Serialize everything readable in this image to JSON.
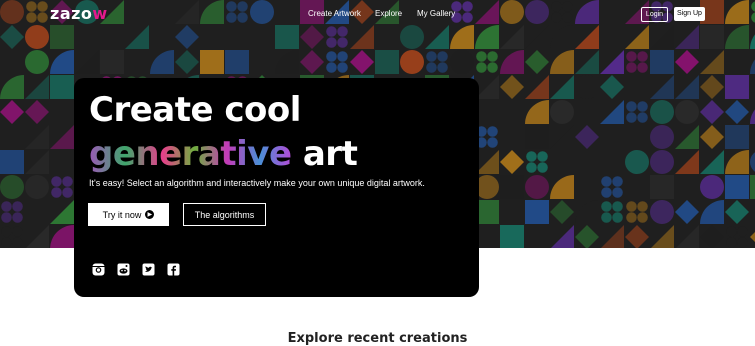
{
  "brand": {
    "logo_text": "zazo",
    "logo_accent": "w",
    "accent_color": "#e4198c"
  },
  "nav": {
    "links": [
      "Create Artwork",
      "Explore",
      "My Gallery"
    ],
    "login_label": "Login",
    "signup_label": "Sign Up"
  },
  "hero": {
    "title_line1": "Create cool",
    "title_highlight": "generative",
    "title_rest": " art",
    "tagline": "It's easy! Select an algorithm and interactively make your own unique digital artwork.",
    "cta_primary": "Try it now",
    "cta_primary_icon": "arrow-circle-right-icon",
    "cta_secondary": "The algorithms",
    "social_icons": [
      "instagram-icon",
      "reddit-icon",
      "twitter-icon",
      "facebook-icon"
    ]
  },
  "sections": {
    "explore_title": "Explore recent creations"
  },
  "palette": [
    "#1e9e88",
    "#3fae49",
    "#2d6cc9",
    "#c1189e",
    "#f0a422",
    "#e05a24",
    "#7a3ccf",
    "#2a2a2a",
    "#3a3a3a"
  ]
}
